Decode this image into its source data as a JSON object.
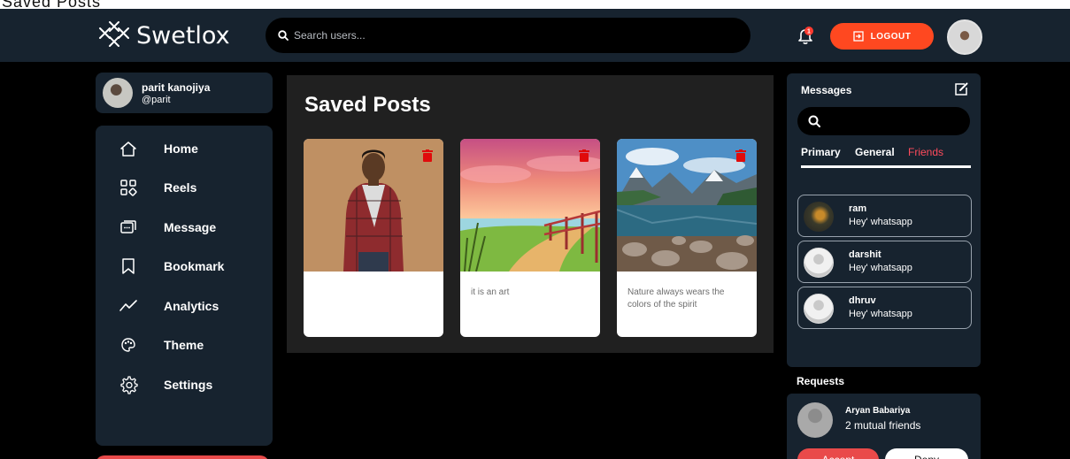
{
  "top_strip": {
    "text": "Saved Posts"
  },
  "brand": {
    "name": "Swetlox"
  },
  "search": {
    "placeholder": "Search users..."
  },
  "notifications": {
    "count": "1"
  },
  "header": {
    "logout_label": "LOGOUT"
  },
  "profile": {
    "name": "parit kanojiya",
    "handle": "@parit"
  },
  "sidebar": {
    "items": [
      {
        "label": "Home",
        "icon": "home-icon"
      },
      {
        "label": "Reels",
        "icon": "reels-icon"
      },
      {
        "label": "Message",
        "icon": "message-icon"
      },
      {
        "label": "Bookmark",
        "icon": "bookmark-icon"
      },
      {
        "label": "Analytics",
        "icon": "analytics-icon"
      },
      {
        "label": "Theme",
        "icon": "palette-icon"
      },
      {
        "label": "Settings",
        "icon": "gear-icon"
      }
    ]
  },
  "saved": {
    "title": "Saved Posts",
    "posts": [
      {
        "caption": ""
      },
      {
        "caption": "it is an art"
      },
      {
        "caption": "Nature always wears the colors of the spirit"
      }
    ]
  },
  "messages": {
    "title": "Messages",
    "tabs": [
      "Primary",
      "General",
      "Friends"
    ],
    "active_tab": "Friends",
    "contacts": [
      {
        "name": "ram",
        "preview": "Hey' whatsapp"
      },
      {
        "name": "darshit",
        "preview": "Hey' whatsapp"
      },
      {
        "name": "dhruv",
        "preview": "Hey' whatsapp"
      }
    ]
  },
  "requests": {
    "title": "Requests",
    "name": "Aryan Babariya",
    "mutual": "2 mutual friends",
    "accept_label": "Accept",
    "deny_label": "Deny"
  },
  "colors": {
    "accent": "#ff4820",
    "panel": "#17232f",
    "background": "#000000",
    "danger": "#e94a4a"
  }
}
